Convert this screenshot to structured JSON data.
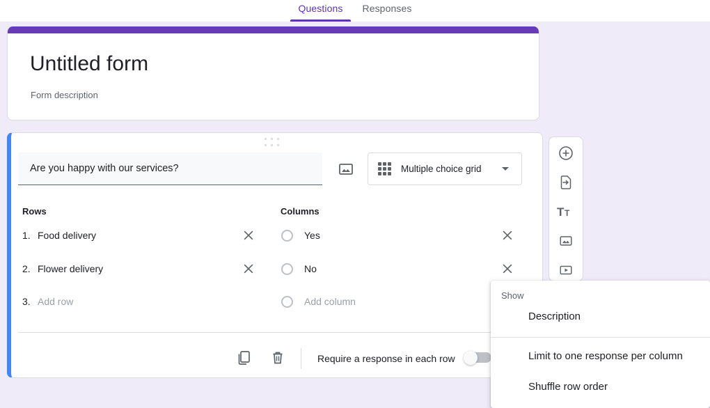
{
  "tabs": [
    {
      "label": "Questions",
      "active": true
    },
    {
      "label": "Responses",
      "active": false
    }
  ],
  "form_header": {
    "title": "Untitled form",
    "description": "Form description"
  },
  "question": {
    "title": "Are you happy with our services?",
    "type_label": "Multiple choice grid",
    "type_icon": "grid-3x3-icon",
    "image_icon": "insert-image-icon",
    "rows_header": "Rows",
    "columns_header": "Columns",
    "rows": [
      {
        "number": "1.",
        "label": "Food delivery",
        "placeholder": false
      },
      {
        "number": "2.",
        "label": "Flower delivery",
        "placeholder": false
      },
      {
        "number": "3.",
        "label": "Add row",
        "placeholder": true
      }
    ],
    "columns": [
      {
        "label": "Yes",
        "placeholder": false
      },
      {
        "label": "No",
        "placeholder": false
      },
      {
        "label": "Add column",
        "placeholder": true
      }
    ],
    "footer": {
      "duplicate_icon": "duplicate-icon",
      "delete_icon": "trash-icon",
      "require_label": "Require a response in each row",
      "require_toggle_on": false
    }
  },
  "side_toolbar": [
    {
      "icon": "add-question-icon"
    },
    {
      "icon": "import-questions-icon"
    },
    {
      "icon": "add-title-icon"
    },
    {
      "icon": "add-image-icon"
    },
    {
      "icon": "add-video-icon"
    }
  ],
  "menu": {
    "section_label": "Show",
    "items_top": [
      {
        "label": "Description"
      }
    ],
    "items_bottom": [
      {
        "label": "Limit to one response per column"
      },
      {
        "label": "Shuffle row order"
      }
    ]
  },
  "colors": {
    "page_background": "#f0ebf8",
    "header_stripe": "#673ab7",
    "tab_active": "#5b36b1",
    "card_accent": "#4285f4",
    "icon_grey": "#5f6368",
    "placeholder_grey": "#9aa0a6"
  }
}
